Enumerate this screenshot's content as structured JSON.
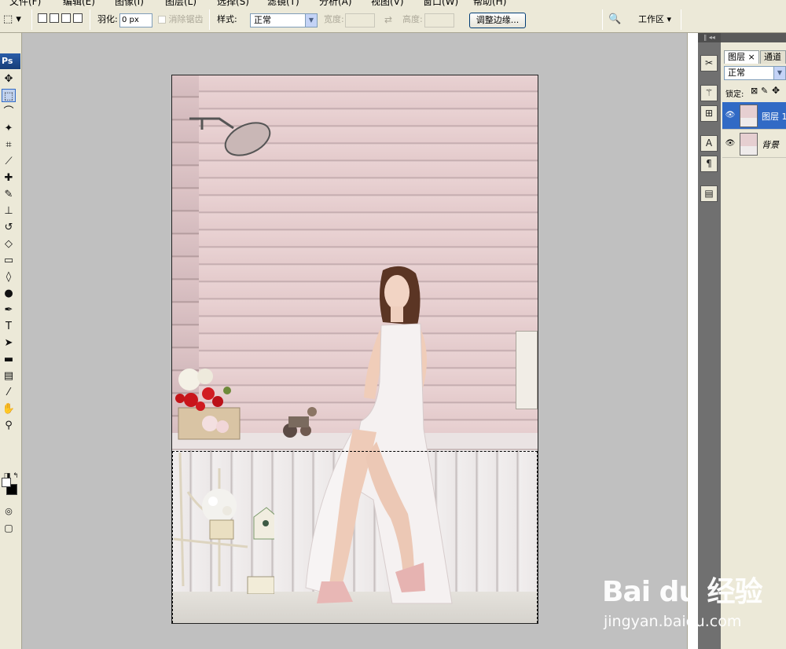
{
  "menubar": {
    "items": [
      "文件(F)",
      "编辑(E)",
      "图像(I)",
      "图层(L)",
      "选择(S)",
      "滤镜(T)",
      "分析(A)",
      "视图(V)",
      "窗口(W)",
      "帮助(H)"
    ]
  },
  "options_bar": {
    "feather_label": "羽化:",
    "feather_value": "0 px",
    "antialias_label": "消除锯齿",
    "style_label": "样式:",
    "style_value": "正常",
    "width_label": "宽度:",
    "height_label": "高度:",
    "refine_edge_button": "调整边缘...",
    "workspace_button": "工作区 ▾"
  },
  "toolbox": {
    "logo": "Ps",
    "tools": [
      {
        "name": "move-tool-icon",
        "glyph": "✥"
      },
      {
        "name": "marquee-tool-icon",
        "glyph": "⬚",
        "active": true
      },
      {
        "name": "lasso-tool-icon",
        "glyph": "⌒"
      },
      {
        "name": "magic-wand-tool-icon",
        "glyph": "✦"
      },
      {
        "name": "crop-tool-icon",
        "glyph": "⌗"
      },
      {
        "name": "slice-tool-icon",
        "glyph": "⟋"
      },
      {
        "name": "healing-brush-tool-icon",
        "glyph": "✚"
      },
      {
        "name": "brush-tool-icon",
        "glyph": "✎"
      },
      {
        "name": "clone-stamp-tool-icon",
        "glyph": "⊥"
      },
      {
        "name": "history-brush-tool-icon",
        "glyph": "↺"
      },
      {
        "name": "eraser-tool-icon",
        "glyph": "◇"
      },
      {
        "name": "gradient-tool-icon",
        "glyph": "▭"
      },
      {
        "name": "blur-tool-icon",
        "glyph": "◊"
      },
      {
        "name": "dodge-tool-icon",
        "glyph": "●"
      },
      {
        "name": "pen-tool-icon",
        "glyph": "✒"
      },
      {
        "name": "type-tool-icon",
        "glyph": "T"
      },
      {
        "name": "path-selection-tool-icon",
        "glyph": "➤"
      },
      {
        "name": "shape-tool-icon",
        "glyph": "▬"
      },
      {
        "name": "notes-tool-icon",
        "glyph": "▤"
      },
      {
        "name": "eyedropper-tool-icon",
        "glyph": "⁄"
      },
      {
        "name": "hand-tool-icon",
        "glyph": "✋"
      },
      {
        "name": "zoom-tool-icon",
        "glyph": "⚲"
      }
    ]
  },
  "layers_panel": {
    "tab_layers": "图层",
    "tab_channels": "通道",
    "blend_mode": "正常",
    "lock_label": "锁定:",
    "layers": [
      {
        "name": "图层 1",
        "selected": true
      },
      {
        "name": "背景",
        "selected": false
      }
    ]
  },
  "watermark": {
    "logo": "Bai du 经验",
    "url": "jingyan.baidu.com"
  }
}
